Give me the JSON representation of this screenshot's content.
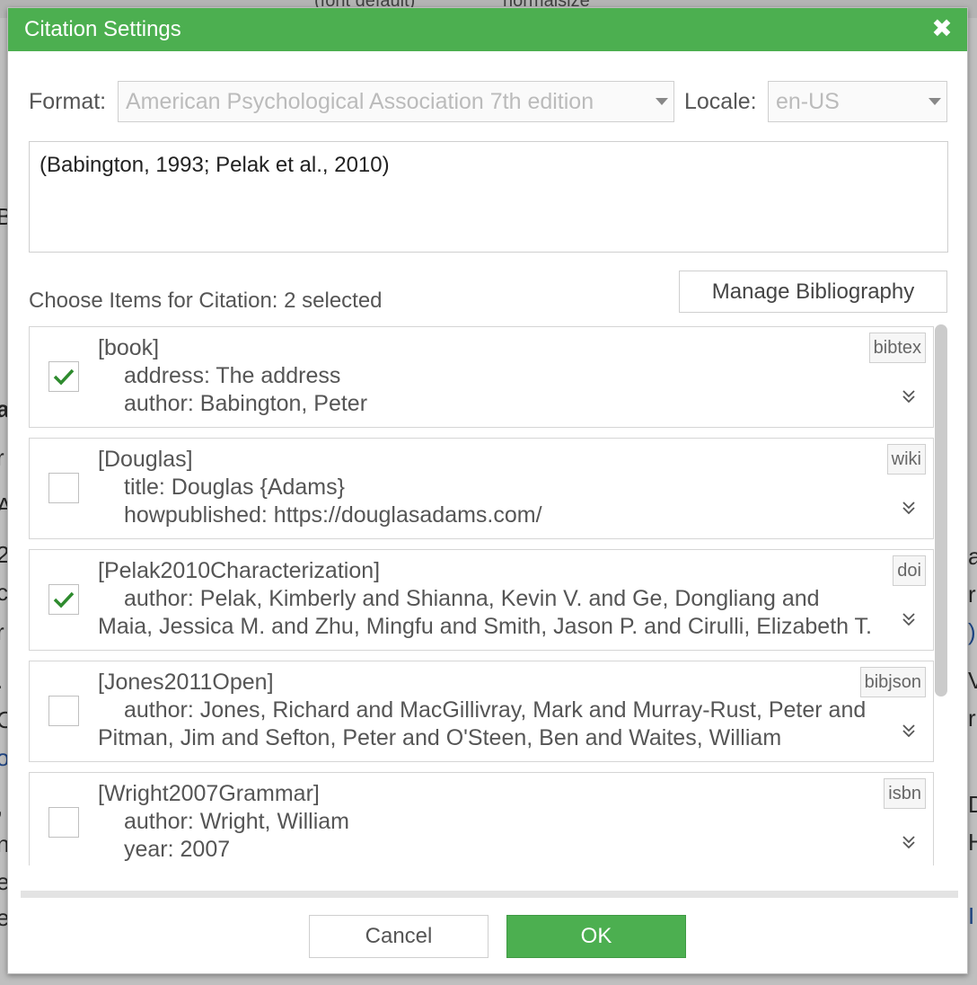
{
  "background": {
    "toolbar_font": "(font default)",
    "toolbar_size": "normalsize",
    "edge_letters_left": [
      "B",
      "a",
      "r",
      "A",
      "2",
      "c",
      "r",
      ".",
      "O",
      "o",
      ",",
      "n",
      "e",
      "e"
    ],
    "edge_letters_right": [
      "a",
      "r",
      ")",
      "V",
      "r",
      "D",
      "H",
      "I"
    ]
  },
  "dialog": {
    "title": "Citation Settings",
    "close_symbol": "✖",
    "format_label": "Format:",
    "format_value": "American Psychological Association 7th edition",
    "locale_label": "Locale:",
    "locale_value": "en-US",
    "preview_text": "(Babington, 1993; Pelak et al., 2010)",
    "choose_label": "Choose Items for Citation: 2 selected",
    "manage_button": "Manage Bibliography",
    "cancel_button": "Cancel",
    "ok_button": "OK"
  },
  "items": [
    {
      "key": "[book]",
      "line1": "address: The address",
      "line2": "author: Babington, Peter",
      "badge": "bibtex",
      "checked": true
    },
    {
      "key": "[Douglas]",
      "line1": "title: Douglas {Adams}",
      "line2": "howpublished: https://douglasadams.com/",
      "badge": "wiki",
      "checked": false
    },
    {
      "key": "[Pelak2010Characterization]",
      "line1": "author: Pelak, Kimberly and Shianna, Kevin V. and Ge, Dongliang and",
      "line2": "Maia, Jessica M. and Zhu, Mingfu and Smith, Jason P. and Cirulli, Elizabeth T.",
      "badge": "doi",
      "checked": true
    },
    {
      "key": "[Jones2011Open]",
      "line1": "author: Jones, Richard and MacGillivray, Mark and Murray-Rust, Peter and",
      "line2": "Pitman, Jim and Sefton, Peter and O'Steen, Ben and Waites, William",
      "badge": "bibjson",
      "checked": false
    },
    {
      "key": "[Wright2007Grammar]",
      "line1": "author: Wright, William",
      "line2": "year: 2007",
      "badge": "isbn",
      "checked": false
    }
  ],
  "colors": {
    "accent": "#4caf50",
    "check": "#2e8b2e"
  }
}
